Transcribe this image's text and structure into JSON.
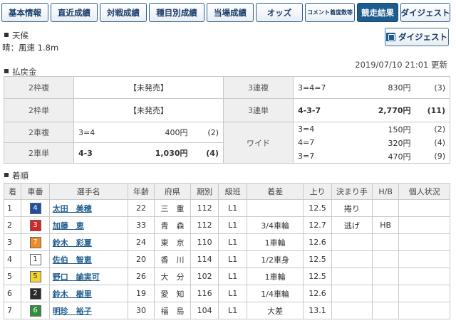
{
  "tabs": [
    {
      "label": "基本情報",
      "width": 66
    },
    {
      "label": "直近成績",
      "width": 66
    },
    {
      "label": "対戦成績",
      "width": 66
    },
    {
      "label": "種目別成績",
      "width": 78
    },
    {
      "label": "当場成績",
      "width": 66
    },
    {
      "label": "オッズ",
      "width": 66
    },
    {
      "label": "コメント着度数等",
      "width": 70,
      "small": true
    },
    {
      "label": "競走結果",
      "width": 58,
      "active": true
    },
    {
      "label": "ダイジェスト",
      "width": 70
    }
  ],
  "weather": {
    "heading": "天候",
    "value": "晴：風速 1.8m"
  },
  "digest_button": "ダイジェスト",
  "updated": "2019/07/10 21:01 更新",
  "payout": {
    "heading": "払戻金",
    "rows": [
      {
        "left_label": "2枠複",
        "left_value": "【未発売】",
        "right_label": "3連複",
        "right": [
          {
            "combo": "3=4=7",
            "amount": "830円",
            "pop": "(3)"
          }
        ]
      },
      {
        "left_label": "2枠単",
        "left_value": "【未発売】",
        "right_label": "3連単",
        "right": [
          {
            "combo": "4-3-7",
            "amount": "2,770円",
            "pop": "(11)",
            "bold": true
          }
        ]
      },
      {
        "left_label": "2車複",
        "left": [
          {
            "combo": "3=4",
            "amount": "400円",
            "pop": "(2)"
          }
        ],
        "right_label": "ワイド",
        "right": [
          {
            "combo": "3=4",
            "amount": "150円",
            "pop": "(2)"
          },
          {
            "combo": "4=7",
            "amount": "320円",
            "pop": "(4)"
          },
          {
            "combo": "3=7",
            "amount": "470円",
            "pop": "(9)"
          }
        ]
      },
      {
        "left_label": "2車単",
        "left": [
          {
            "combo": "4-3",
            "amount": "1,030円",
            "pop": "(4)",
            "bold": true
          }
        ]
      }
    ]
  },
  "results": {
    "heading": "着順",
    "columns": [
      "着",
      "車番",
      "選手名",
      "年齢",
      "府県",
      "期別",
      "級班",
      "着差",
      "上り",
      "決まり手",
      "H/B",
      "個人状況"
    ],
    "rows": [
      {
        "rank": "1",
        "car": "4",
        "car_bg": "#1f4fa3",
        "car_fg": "#ffffff",
        "name": "太田　美穂",
        "age": "22",
        "pref": "三　重",
        "term": "112",
        "cls": "L1",
        "margin": "",
        "agari": "12.5",
        "kimarite": "捲り",
        "hb": "",
        "status": ""
      },
      {
        "rank": "2",
        "car": "3",
        "car_bg": "#d42626",
        "car_fg": "#ffffff",
        "name": "加藤　恵",
        "age": "33",
        "pref": "青　森",
        "term": "112",
        "cls": "L1",
        "margin": "3/4車輪",
        "agari": "12.7",
        "kimarite": "逃げ",
        "hb": "HB",
        "status": ""
      },
      {
        "rank": "3",
        "car": "7",
        "car_bg": "#f08c28",
        "car_fg": "#ffffff",
        "name": "鈴木　彩夏",
        "age": "24",
        "pref": "東　京",
        "term": "110",
        "cls": "L1",
        "margin": "1車輪",
        "agari": "12.6",
        "kimarite": "",
        "hb": "",
        "status": ""
      },
      {
        "rank": "4",
        "car": "1",
        "car_bg": "#ffffff",
        "car_fg": "#333333",
        "name": "佐伯　智恵",
        "age": "20",
        "pref": "香　川",
        "term": "114",
        "cls": "L1",
        "margin": "1/2車身",
        "agari": "12.5",
        "kimarite": "",
        "hb": "",
        "status": ""
      },
      {
        "rank": "5",
        "car": "5",
        "car_bg": "#f4d232",
        "car_fg": "#333333",
        "name": "野口　諭実可",
        "age": "26",
        "pref": "大　分",
        "term": "102",
        "cls": "L1",
        "margin": "1車輪",
        "agari": "12.5",
        "kimarite": "",
        "hb": "",
        "status": ""
      },
      {
        "rank": "6",
        "car": "2",
        "car_bg": "#2b2b2b",
        "car_fg": "#ffffff",
        "name": "鈴木　樹里",
        "age": "19",
        "pref": "愛　知",
        "term": "116",
        "cls": "L1",
        "margin": "1/4車輪",
        "agari": "12.6",
        "kimarite": "",
        "hb": "",
        "status": ""
      },
      {
        "rank": "7",
        "car": "6",
        "car_bg": "#2f8f3a",
        "car_fg": "#ffffff",
        "name": "明珍　裕子",
        "age": "30",
        "pref": "福　島",
        "term": "104",
        "cls": "L1",
        "margin": "大差",
        "agari": "13.1",
        "kimarite": "",
        "hb": "",
        "status": ""
      }
    ]
  }
}
